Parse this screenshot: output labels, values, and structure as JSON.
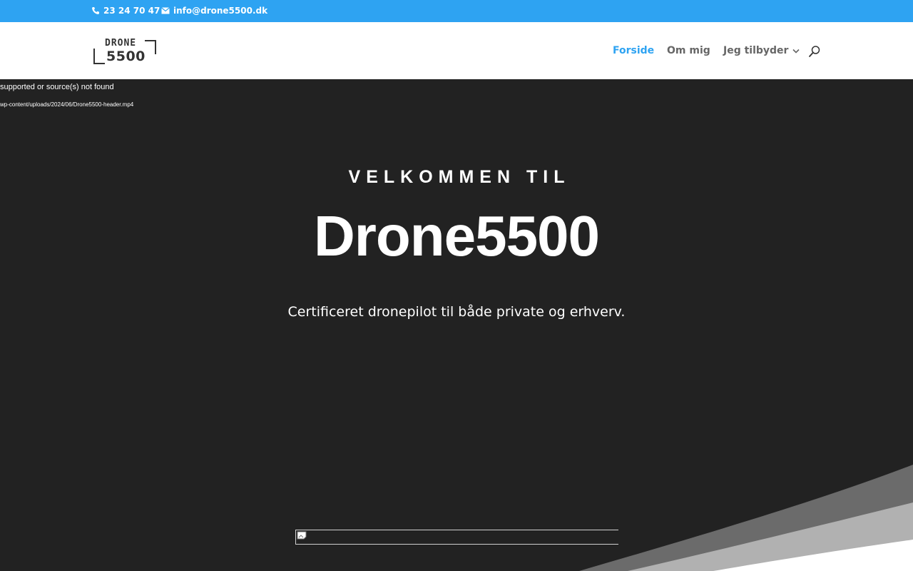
{
  "topbar": {
    "phone": "23 24 70 47",
    "email": "info@drone5500.dk",
    "bg_color": "#2ea3f2"
  },
  "logo": {
    "line1": "DRONE",
    "line2": "5500"
  },
  "nav": {
    "items": [
      {
        "label": "Forside",
        "active": true
      },
      {
        "label": "Om mig",
        "active": false
      },
      {
        "label": "Jeg tilbyder",
        "active": false,
        "has_dropdown": true
      }
    ],
    "active_color": "#2ea3f2",
    "text_color": "#666666"
  },
  "hero": {
    "video_error": "supported or source(s) not found",
    "video_src": "wp-content/uploads/2024/06/Drone5500-header.mp4",
    "kicker": "VELKOMMEN TIL",
    "title": "Drone5500",
    "subtitle": "Certificeret dronepilot til både private og erhverv.",
    "bg_color": "#222222"
  },
  "icons": {
    "phone": "phone-icon",
    "email": "envelope-icon",
    "search": "search-icon",
    "dropdown": "chevron-down-icon",
    "broken_image": "broken-image-icon"
  }
}
